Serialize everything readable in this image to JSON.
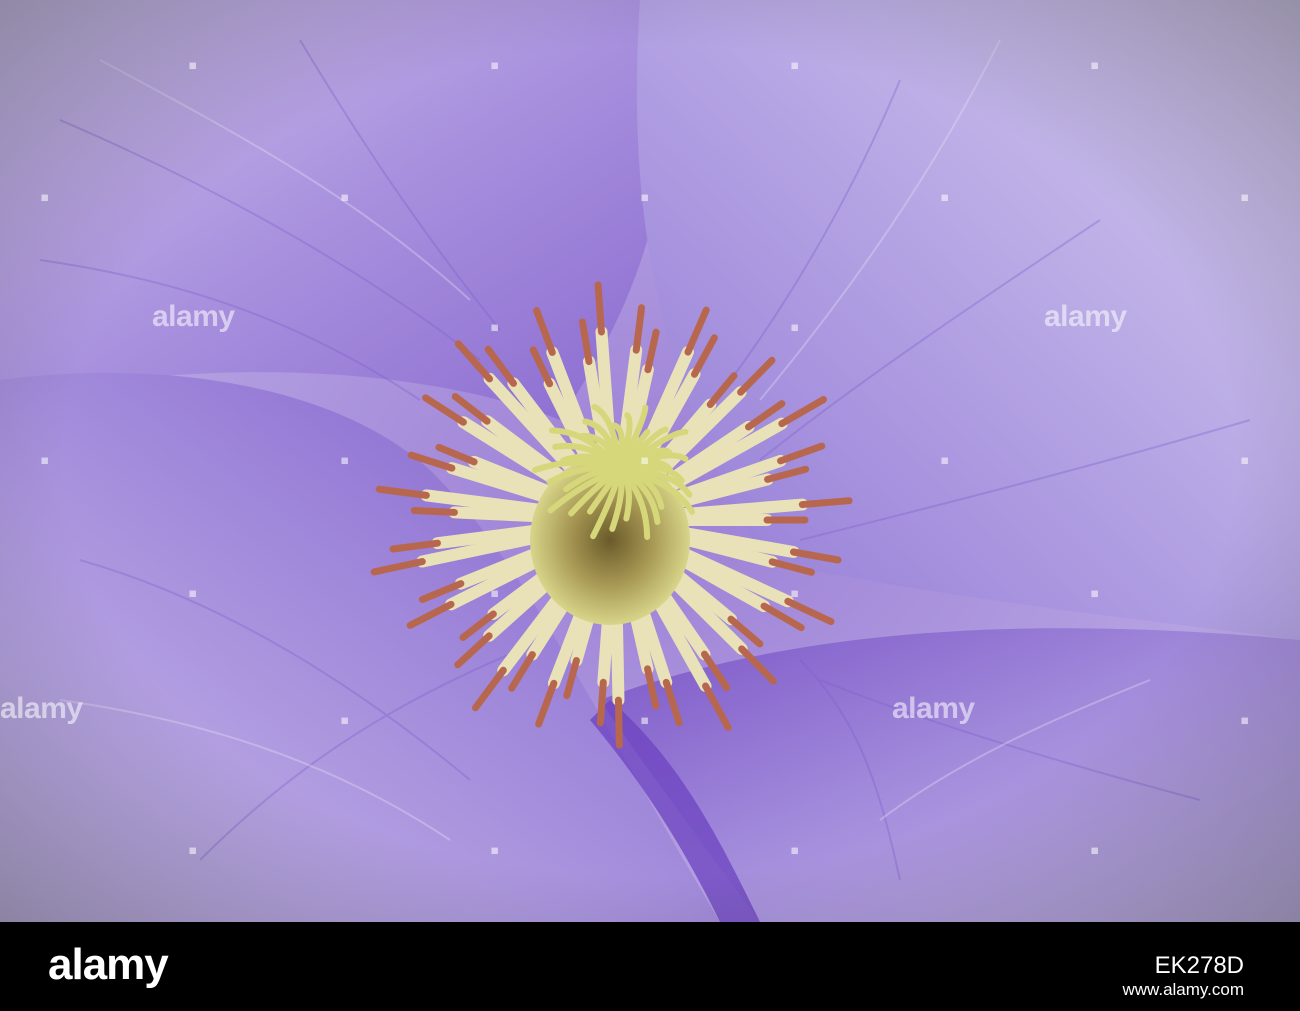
{
  "watermark": {
    "text": "alamy",
    "accent_color": "#ffffff"
  },
  "footer": {
    "logo": "alamy",
    "image_id": "EK278D",
    "url": "www.alamy.com"
  },
  "photo": {
    "subject": "purple clematis flower close-up",
    "petal_color": "#a693d9",
    "vein_color": "#7b5bc9",
    "stamen_color": "#e9e2b8",
    "anther_tip_color": "#b8674f",
    "center_color": "#d6d77a"
  }
}
